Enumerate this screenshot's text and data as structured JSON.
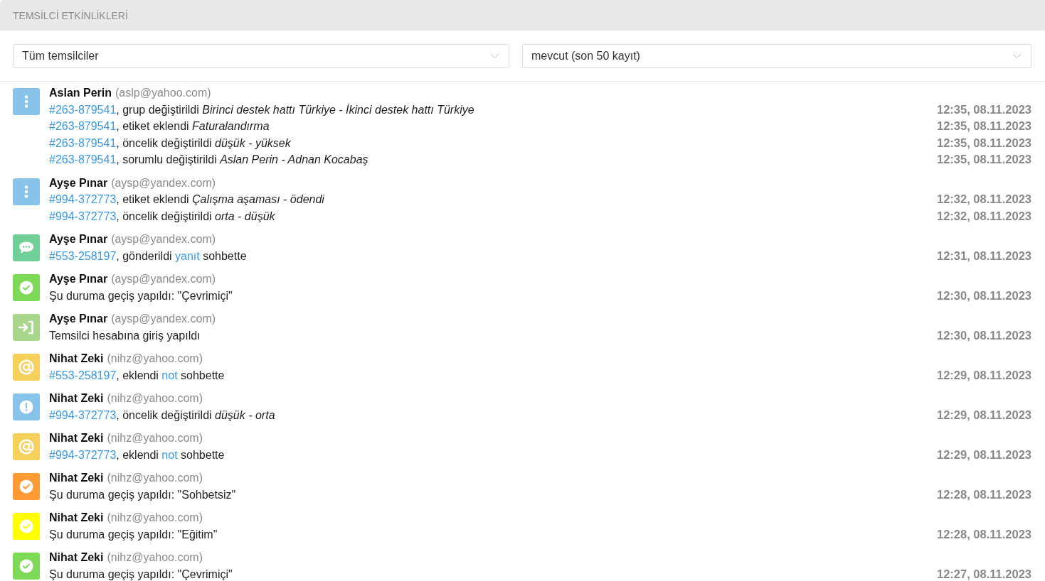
{
  "panel": {
    "title": "TEMSİLCİ ETKİNLİKLERİ"
  },
  "filters": [
    {
      "value": "Tüm temsilciler"
    },
    {
      "value": "mevcut (son 50 kayıt)"
    }
  ],
  "events": [
    {
      "kind": "dots",
      "color": "#88c4ea",
      "agent": "Aslan Perin",
      "email": "(aslp@yahoo.com)",
      "lines": [
        {
          "parts": [
            {
              "kind": "ticket",
              "text": "#263-879541"
            },
            {
              "kind": "plain",
              "text": ", grup değiştirildi "
            },
            {
              "kind": "italic",
              "text": "Birinci destek hattı Türkiye - İkinci destek hattı Türkiye"
            }
          ],
          "time": "12:35, 08.11.2023"
        },
        {
          "parts": [
            {
              "kind": "ticket",
              "text": "#263-879541"
            },
            {
              "kind": "plain",
              "text": ", etiket eklendi "
            },
            {
              "kind": "italic",
              "text": "Faturalandırma"
            }
          ],
          "time": "12:35, 08.11.2023"
        },
        {
          "parts": [
            {
              "kind": "ticket",
              "text": "#263-879541"
            },
            {
              "kind": "plain",
              "text": ", öncelik değiştirildi "
            },
            {
              "kind": "italic",
              "text": "düşük - yüksek"
            }
          ],
          "time": "12:35, 08.11.2023"
        },
        {
          "parts": [
            {
              "kind": "ticket",
              "text": "#263-879541"
            },
            {
              "kind": "plain",
              "text": ", sorumlu değiştirildi "
            },
            {
              "kind": "italic",
              "text": "Aslan Perin - Adnan Kocabaş"
            }
          ],
          "time": "12:35, 08.11.2023"
        }
      ]
    },
    {
      "kind": "dots",
      "color": "#88c4ea",
      "agent": "Ayşe Pınar",
      "email": "(aysp@yandex.com)",
      "lines": [
        {
          "parts": [
            {
              "kind": "ticket",
              "text": "#994-372773"
            },
            {
              "kind": "plain",
              "text": ", etiket eklendi "
            },
            {
              "kind": "italic",
              "text": "Çalışma aşaması - ödendi"
            }
          ],
          "time": "12:32, 08.11.2023"
        },
        {
          "parts": [
            {
              "kind": "ticket",
              "text": "#994-372773"
            },
            {
              "kind": "plain",
              "text": ", öncelik değiştirildi "
            },
            {
              "kind": "italic",
              "text": "orta - düşük"
            }
          ],
          "time": "12:32, 08.11.2023"
        }
      ]
    },
    {
      "kind": "chat",
      "color": "#6fcf97",
      "agent": "Ayşe Pınar",
      "email": "(aysp@yandex.com)",
      "lines": [
        {
          "parts": [
            {
              "kind": "ticket",
              "text": "#553-258197"
            },
            {
              "kind": "plain",
              "text": ", gönderildi "
            },
            {
              "kind": "link",
              "text": "yanıt"
            },
            {
              "kind": "plain",
              "text": " sohbette"
            }
          ],
          "time": "12:31, 08.11.2023"
        }
      ]
    },
    {
      "kind": "check",
      "color": "#7ed957",
      "agent": "Ayşe Pınar",
      "email": "(aysp@yandex.com)",
      "lines": [
        {
          "parts": [
            {
              "kind": "plain",
              "text": "Şu duruma geçiş yapıldı: \"Çevrimiçi\""
            }
          ],
          "time": "12:30, 08.11.2023"
        }
      ]
    },
    {
      "kind": "login",
      "color": "#a8d68b",
      "agent": "Ayşe Pınar",
      "email": "(aysp@yandex.com)",
      "lines": [
        {
          "parts": [
            {
              "kind": "plain",
              "text": "Temsilci hesabına giriş yapıldı"
            }
          ],
          "time": "12:30, 08.11.2023"
        }
      ]
    },
    {
      "kind": "at",
      "color": "#f5d05a",
      "agent": "Nihat Zeki",
      "email": "(nihz@yahoo.com)",
      "lines": [
        {
          "parts": [
            {
              "kind": "ticket",
              "text": "#553-258197"
            },
            {
              "kind": "plain",
              "text": ", eklendi "
            },
            {
              "kind": "link",
              "text": "not"
            },
            {
              "kind": "plain",
              "text": " sohbette"
            }
          ],
          "time": "12:29, 08.11.2023"
        }
      ]
    },
    {
      "kind": "alert",
      "color": "#88c4ea",
      "agent": "Nihat Zeki",
      "email": "(nihz@yahoo.com)",
      "lines": [
        {
          "parts": [
            {
              "kind": "ticket",
              "text": "#994-372773"
            },
            {
              "kind": "plain",
              "text": ", öncelik değiştirildi "
            },
            {
              "kind": "italic",
              "text": "düşük - orta"
            }
          ],
          "time": "12:29, 08.11.2023"
        }
      ]
    },
    {
      "kind": "at",
      "color": "#f5d05a",
      "agent": "Nihat Zeki",
      "email": "(nihz@yahoo.com)",
      "lines": [
        {
          "parts": [
            {
              "kind": "ticket",
              "text": "#994-372773"
            },
            {
              "kind": "plain",
              "text": ", eklendi "
            },
            {
              "kind": "link",
              "text": "not"
            },
            {
              "kind": "plain",
              "text": " sohbette"
            }
          ],
          "time": "12:29, 08.11.2023"
        }
      ]
    },
    {
      "kind": "check",
      "color": "#ff9a35",
      "agent": "Nihat Zeki",
      "email": "(nihz@yahoo.com)",
      "lines": [
        {
          "parts": [
            {
              "kind": "plain",
              "text": "Şu duruma geçiş yapıldı: \"Sohbetsiz\""
            }
          ],
          "time": "12:28, 08.11.2023"
        }
      ]
    },
    {
      "kind": "check",
      "color": "#ffff00",
      "agent": "Nihat Zeki",
      "email": "(nihz@yahoo.com)",
      "lines": [
        {
          "parts": [
            {
              "kind": "plain",
              "text": "Şu duruma geçiş yapıldı: \"Eğitim\""
            }
          ],
          "time": "12:28, 08.11.2023"
        }
      ]
    },
    {
      "kind": "check",
      "color": "#7ed957",
      "agent": "Nihat Zeki",
      "email": "(nihz@yahoo.com)",
      "lines": [
        {
          "parts": [
            {
              "kind": "plain",
              "text": "Şu duruma geçiş yapıldı: \"Çevrimiçi\""
            }
          ],
          "time": "12:27, 08.11.2023"
        }
      ]
    }
  ]
}
